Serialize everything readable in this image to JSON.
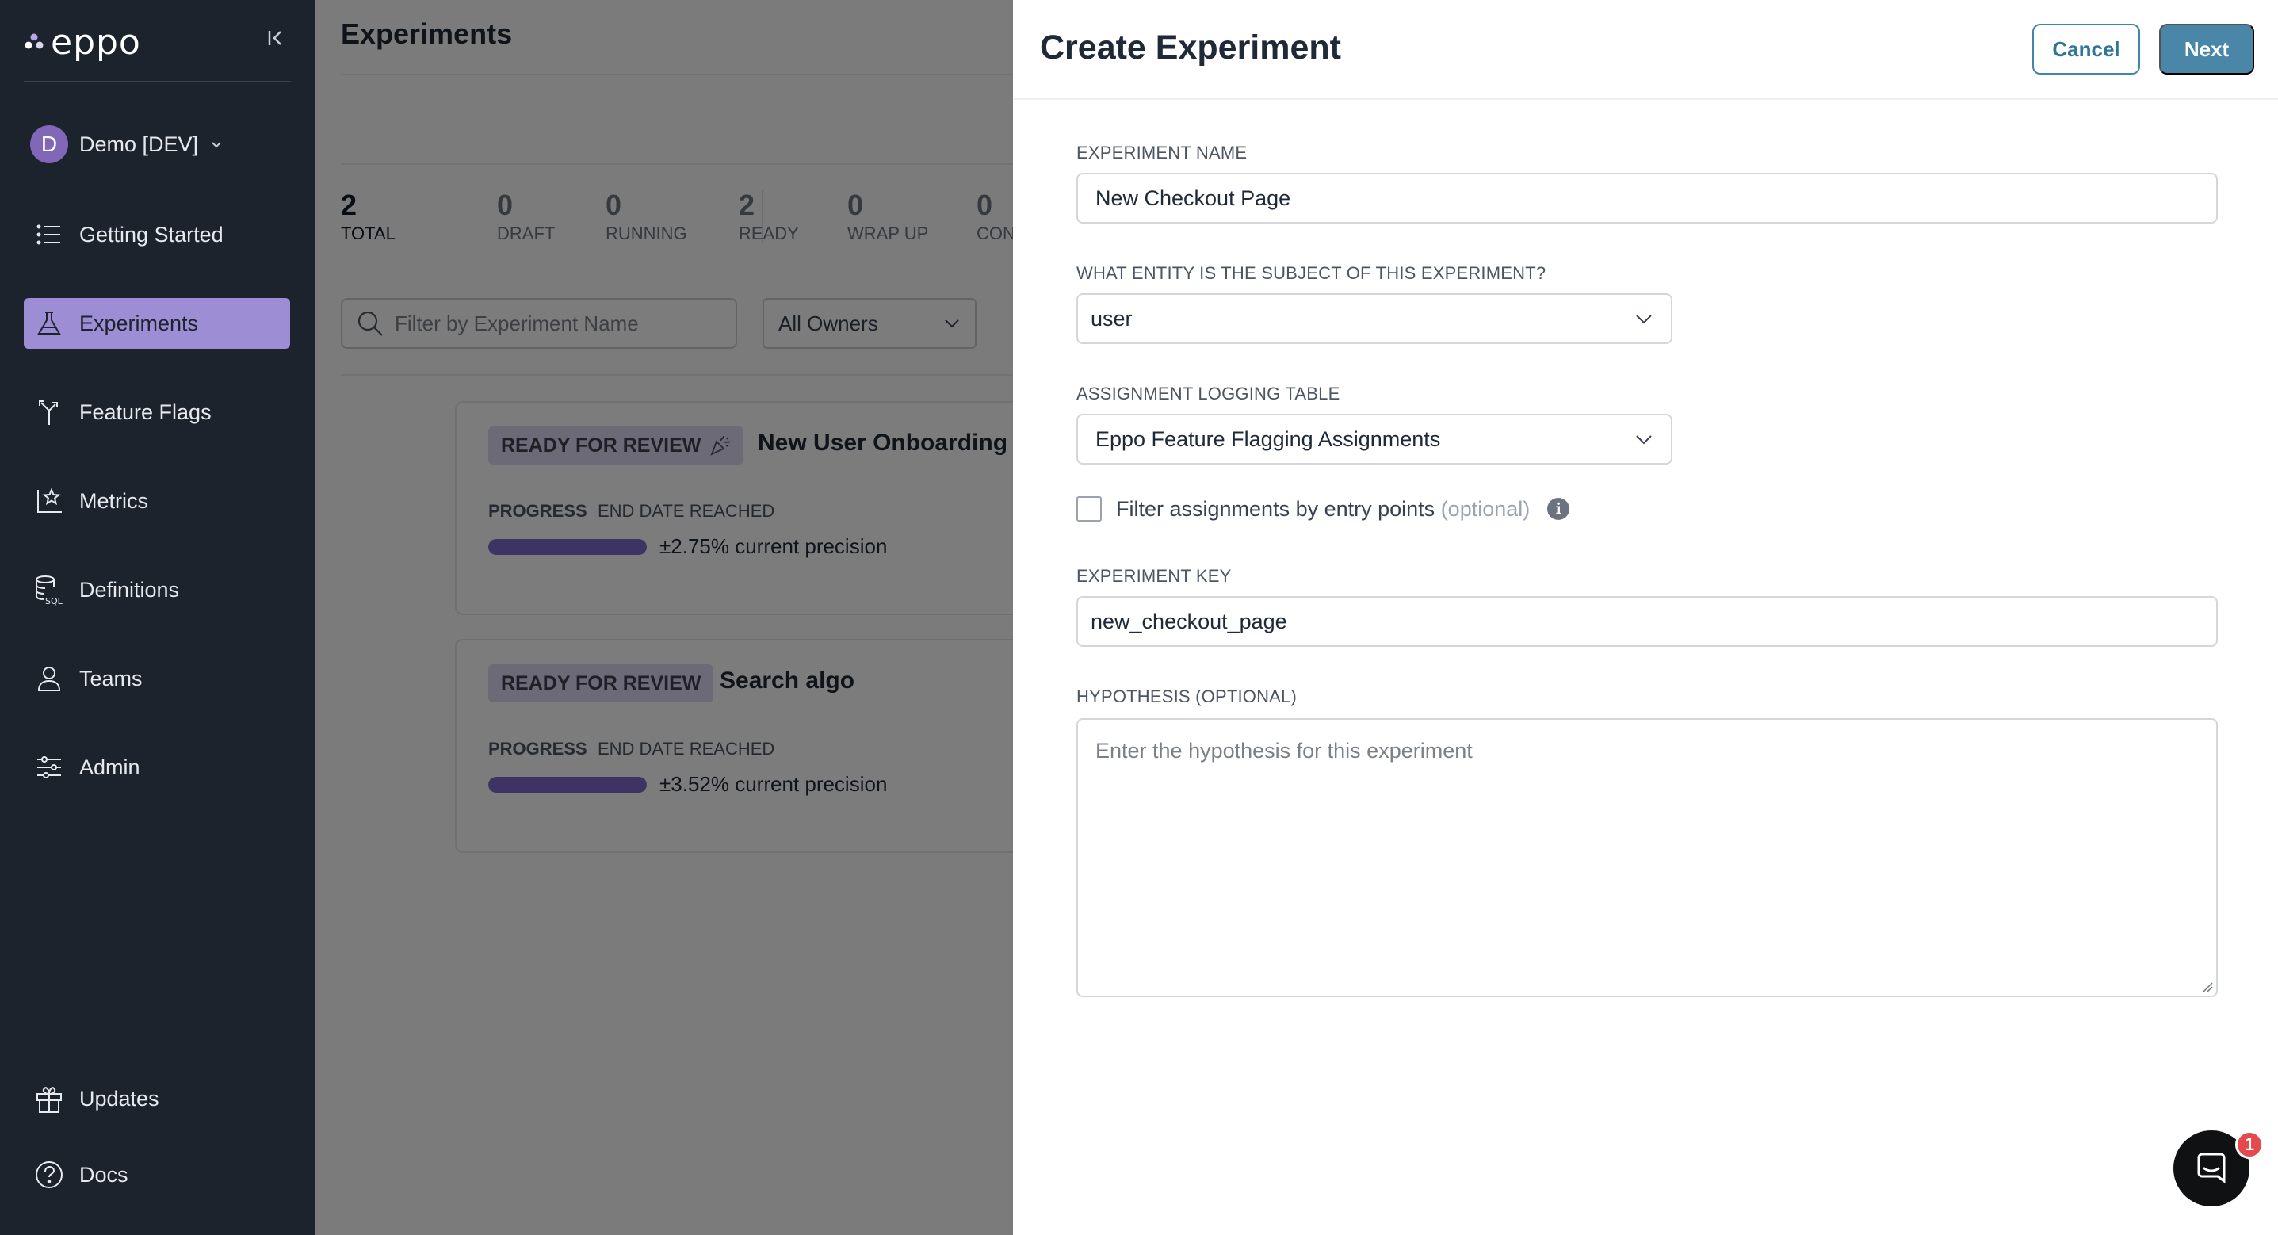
{
  "app": {
    "logo_text": "eppo"
  },
  "sidebar": {
    "workspace": {
      "avatar_letter": "D",
      "label": "Demo [DEV]"
    },
    "items": [
      {
        "label": "Getting Started",
        "icon": "list-icon"
      },
      {
        "label": "Experiments",
        "icon": "flask-icon",
        "active": true
      },
      {
        "label": "Feature Flags",
        "icon": "flag-branch-icon"
      },
      {
        "label": "Metrics",
        "icon": "chart-star-icon"
      },
      {
        "label": "Definitions",
        "icon": "database-sql-icon"
      },
      {
        "label": "Teams",
        "icon": "users-icon"
      },
      {
        "label": "Admin",
        "icon": "sliders-icon"
      }
    ],
    "bottom_items": [
      {
        "label": "Updates",
        "icon": "gift-icon"
      },
      {
        "label": "Docs",
        "icon": "help-circle-icon"
      }
    ]
  },
  "main": {
    "title": "Experiments",
    "stats": [
      {
        "value": "2",
        "label": "TOTAL"
      },
      {
        "value": "0",
        "label": "DRAFT"
      },
      {
        "value": "0",
        "label": "RUNNING"
      },
      {
        "value": "2",
        "label": "READY"
      },
      {
        "value": "0",
        "label": "WRAP UP"
      },
      {
        "value": "0",
        "label": "CON"
      }
    ],
    "search_placeholder": "Filter by Experiment Name",
    "owners_filter": "All Owners",
    "cards": [
      {
        "status": "READY FOR REVIEW",
        "name": "New User Onboarding",
        "progress_label": "PROGRESS",
        "end_label": "END DATE REACHED",
        "progress": 1.0,
        "precision": "±2.75% current precision"
      },
      {
        "status": "READY FOR REVIEW",
        "name": "Search algo",
        "progress_label": "PROGRESS",
        "end_label": "END DATE REACHED",
        "progress": 1.0,
        "precision": "±3.52% current precision"
      }
    ]
  },
  "drawer": {
    "title": "Create Experiment",
    "cancel_label": "Cancel",
    "next_label": "Next",
    "fields": {
      "name_label": "EXPERIMENT NAME",
      "name_value": "New Checkout Page",
      "entity_label": "WHAT ENTITY IS THE SUBJECT OF THIS EXPERIMENT?",
      "entity_value": "user",
      "table_label": "ASSIGNMENT LOGGING TABLE",
      "table_value": "Eppo Feature Flagging Assignments",
      "filter_label": "Filter assignments by entry points",
      "filter_optional": "(optional)",
      "key_label": "EXPERIMENT KEY",
      "key_value": "new_checkout_page",
      "hypothesis_label": "HYPOTHESIS (OPTIONAL)",
      "hypothesis_placeholder": "Enter the hypothesis for this experiment"
    }
  },
  "chat": {
    "badge_count": "1"
  },
  "colors": {
    "sidebar_bg": "#1d232c",
    "active_item": "#9c8dd4",
    "primary_button": "#4a86a8",
    "progress": "#7a69c7"
  }
}
